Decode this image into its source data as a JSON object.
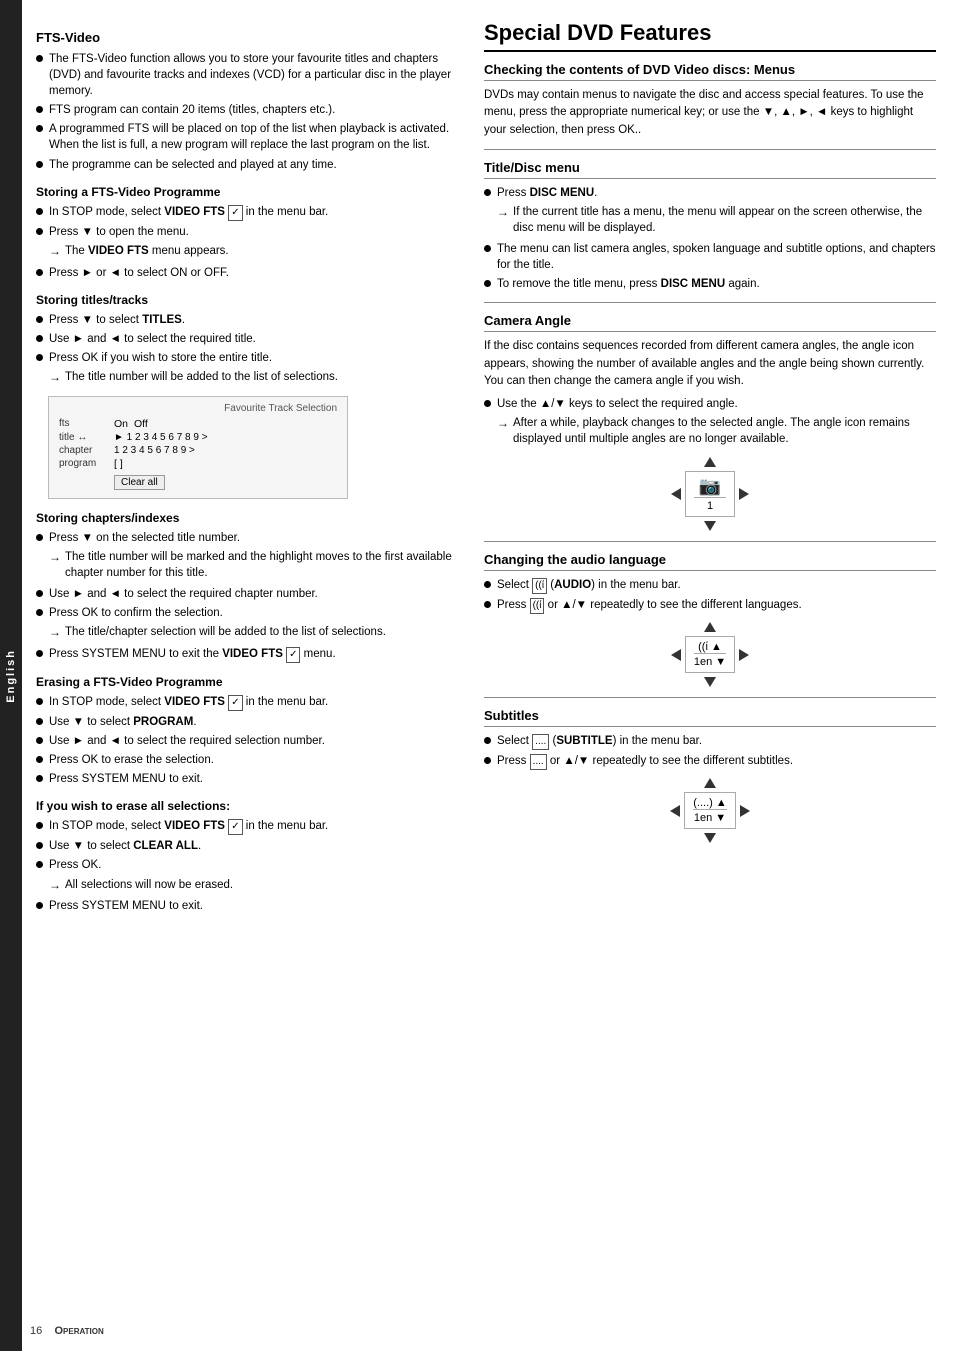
{
  "side_tab": {
    "label": "English"
  },
  "left": {
    "title": "FTS-Video",
    "intro_bullets": [
      "The FTS-Video function allows you to store your favourite titles and chapters (DVD) and favourite tracks and indexes (VCD) for a particular disc in the player memory.",
      "FTS program can contain 20 items (titles, chapters etc.).",
      "A programmed FTS will be placed on top of the list when playback is activated. When the list is full, a new program will replace the last program on the list.",
      "The programme can be selected and played at any time."
    ],
    "storing_programme": {
      "title": "Storing a FTS-Video Programme",
      "bullets": [
        {
          "text": "In STOP mode, select ",
          "bold": "VIDEO FTS",
          "suffix": " in the menu bar.",
          "icon": true
        },
        {
          "text": "Press ▼ to open the menu."
        },
        {
          "text": "→ The ",
          "bold": "VIDEO FTS",
          "suffix": " menu appears.",
          "sub": true
        },
        {
          "text": "Press ► or ◄  to select ON or OFF."
        }
      ]
    },
    "storing_titles": {
      "title": "Storing titles/tracks",
      "bullets": [
        {
          "text": "Press ▼ to select ",
          "bold": "TITLES",
          "suffix": "."
        },
        {
          "text": "Use ► and ◄ to select the required title."
        },
        {
          "text": "Press OK if you wish to store the entire title."
        },
        {
          "text": "→ The title number will be added to the list of selections.",
          "sub": true
        }
      ]
    },
    "fts_table": {
      "title": "Favourite Track Selection",
      "fts_label": "fts",
      "on_off": "On  Off",
      "title_row_label": "title ↔",
      "title_values": "1 2 3 4 5 6 7 8 9 >",
      "chapter_label": "chapter",
      "chapter_values": "1 2 3 4 5 6 7 8 9 >",
      "program_label": "program",
      "program_value": "[ ]",
      "clear_all": "Clear all"
    },
    "storing_chapters": {
      "title": "Storing chapters/indexes",
      "bullets": [
        {
          "text": "Press ▼ on the selected title number."
        },
        {
          "text": "→ The title number will be marked and the highlight moves to the first available chapter number for this title.",
          "sub": true
        },
        {
          "text": "Use ► and ◄ to select the required chapter number."
        },
        {
          "text": "Press OK to confirm the selection."
        },
        {
          "text": "→ The title/chapter selection will be added to the list of selections.",
          "sub": true
        },
        {
          "text": "Press SYSTEM MENU to exit the ",
          "bold": "VIDEO FTS",
          "suffix": " menu.",
          "icon": true
        }
      ]
    },
    "erasing_programme": {
      "title": "Erasing a FTS-Video Programme",
      "bullets": [
        {
          "text": "In STOP mode, select ",
          "bold": "VIDEO FTS",
          "suffix": " in the menu bar.",
          "icon": true
        },
        {
          "text": "Use ▼ to select ",
          "bold": "PROGRAM",
          "suffix": "."
        },
        {
          "text": "Use ► and ◄ to select the required selection number."
        },
        {
          "text": "Press OK to erase the selection."
        },
        {
          "text": "Press SYSTEM MENU to exit."
        }
      ]
    },
    "erase_all": {
      "title": "If you wish to erase all selections:",
      "bullets": [
        {
          "text": "In STOP mode, select ",
          "bold": "VIDEO FTS",
          "suffix": " in the menu bar.",
          "icon": true
        },
        {
          "text": "Use ▼ to select ",
          "bold": "CLEAR ALL",
          "suffix": "."
        },
        {
          "text": "Press OK."
        },
        {
          "text": "→ All selections will now be erased.",
          "sub": true
        },
        {
          "text": "Press SYSTEM MENU to exit."
        }
      ]
    }
  },
  "right": {
    "main_title": "Special DVD Features",
    "checking_section": {
      "title": "Checking the contents of DVD Video discs: Menus",
      "body": "DVDs may contain menus to navigate the disc and access special features. To use the menu, press the appropriate numerical key; or use the ▼, ▲, ►, ◄ keys to highlight your selection, then press OK.."
    },
    "title_disc_menu": {
      "title": "Title/Disc menu",
      "bullets": [
        {
          "text": "Press ",
          "bold": "DISC MENU",
          "suffix": "."
        },
        {
          "text": "→ If the current title has a menu, the menu will appear on the screen otherwise, the disc menu will be displayed.",
          "sub": true
        },
        {
          "text": "The menu can list camera angles, spoken language and subtitle options, and chapters for the title."
        },
        {
          "text": "To remove the title menu, press ",
          "bold": "DISC MENU",
          "suffix": " again."
        }
      ]
    },
    "camera_angle": {
      "title": "Camera Angle",
      "body": "If the disc contains sequences recorded from different camera angles, the angle icon appears, showing the number of available angles and the angle being shown currently. You can then change the camera angle if you wish.",
      "bullets": [
        {
          "text": "Use the ▲/▼ keys to select the required angle."
        },
        {
          "text": "→ After a while, playback changes to the selected angle. The angle  icon remains displayed until multiple angles are no longer available.",
          "sub": true
        }
      ],
      "diagram": {
        "icon": "camera",
        "center_text": "1",
        "arrows": [
          "up",
          "left",
          "right",
          "down"
        ]
      }
    },
    "changing_audio": {
      "title": "Changing the audio language",
      "bullets": [
        {
          "text": "Select ",
          "icon_text": "((ί",
          "bold": "(AUDIO)",
          "suffix": " in the menu bar."
        },
        {
          "text": "Press ",
          "icon_text": "((ί",
          "suffix": " or ▲/▼ repeatedly to see the different languages."
        }
      ],
      "diagram": {
        "center_text": "1en",
        "arrows": [
          "up",
          "left",
          "right",
          "down"
        ]
      }
    },
    "subtitles": {
      "title": "Subtitles",
      "bullets": [
        {
          "text": "Select ",
          "icon_text": "[....]",
          "bold": "(SUBTITLE)",
          "suffix": " in the menu bar."
        },
        {
          "text": "Press ",
          "icon_text": "[....]",
          "suffix": " or ▲/▼ repeatedly to see the different subtitles."
        }
      ],
      "diagram": {
        "center_text": "1en",
        "arrows": [
          "up",
          "left",
          "right",
          "down"
        ]
      }
    }
  },
  "footer": {
    "page_number": "16",
    "section_label": "Operation"
  }
}
